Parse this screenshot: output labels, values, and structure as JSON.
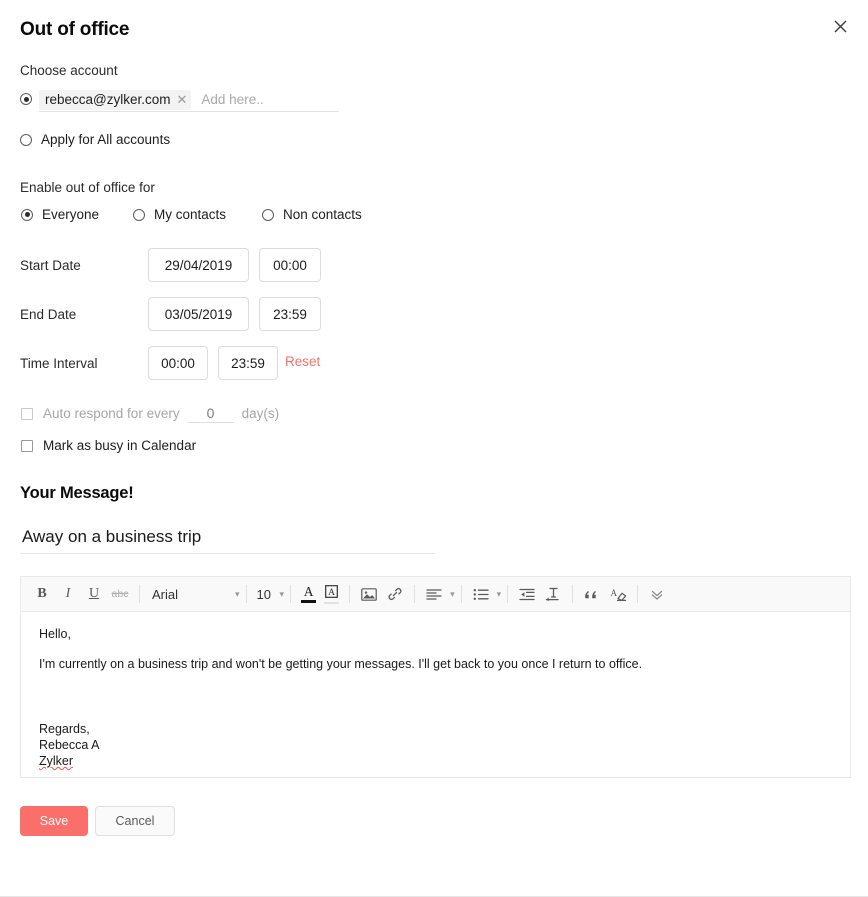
{
  "dialog": {
    "title": "Out of office",
    "close_icon": "close-icon"
  },
  "account": {
    "section_label": "Choose account",
    "selected_option": "specific",
    "chip_email": "rebecca@zylker.com",
    "chip_remove_icon": "close-icon",
    "add_placeholder": "Add here..",
    "add_value": "",
    "all_accounts_label": "Apply for All accounts"
  },
  "audience": {
    "section_label": "Enable out of office for",
    "options": [
      {
        "label": "Everyone",
        "checked": true
      },
      {
        "label": "My contacts",
        "checked": false
      },
      {
        "label": "Non contacts",
        "checked": false
      }
    ]
  },
  "schedule": {
    "start_label": "Start Date",
    "start_date": "29/04/2019",
    "start_time": "00:00",
    "end_label": "End Date",
    "end_date": "03/05/2019",
    "end_time": "23:59",
    "interval_label": "Time Interval",
    "interval_from": "00:00",
    "interval_to": "23:59",
    "reset_label": "Reset"
  },
  "options": {
    "auto_respond_label": "Auto respond for every",
    "auto_respond_checked": false,
    "auto_respond_disabled": true,
    "days_value": "0",
    "days_suffix": "day(s)",
    "mark_busy_label": "Mark as busy in Calendar",
    "mark_busy_checked": false
  },
  "message": {
    "heading": "Your Message!",
    "subject": "Away on a business trip",
    "subject_placeholder": "",
    "body_line1": "Hello,",
    "body_line2": "I'm currently on a business trip and won't be getting your messages. I'll get back to you once I return to office.",
    "sig_line1": "Regards,",
    "sig_line2": "Rebecca A",
    "sig_line3": "Zylker"
  },
  "toolbar": {
    "bold": "B",
    "italic": "I",
    "underline": "U",
    "strikethrough": "abc",
    "font_family": "Arial",
    "font_size": "10",
    "caret": "▾",
    "text_color_glyph": "A",
    "text_color_value": "#111111",
    "highlight_glyph": "A",
    "highlight_value": "#ffffff",
    "icons": {
      "image": "image-icon",
      "link": "link-icon",
      "align": "align-left-icon",
      "list": "bullet-list-icon",
      "indent": "indent-icon",
      "clear_format": "clear-formatting-icon",
      "blockquote": "blockquote-icon",
      "eraser": "eraser-icon",
      "more": "chevron-down-double-icon"
    },
    "blockquote_glyph": "”"
  },
  "footer": {
    "save_label": "Save",
    "cancel_label": "Cancel"
  },
  "colors": {
    "accent": "#fa6f6a",
    "text": "#1a1a1a",
    "muted": "#a6a6a6",
    "border": "#e3e3e3"
  }
}
